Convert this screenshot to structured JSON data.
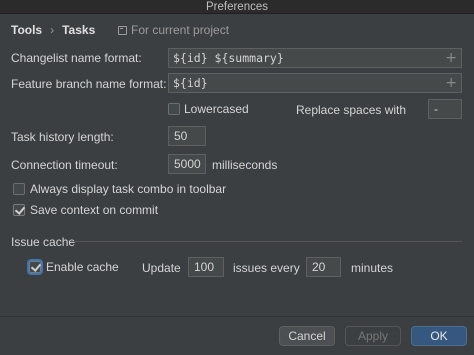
{
  "window": {
    "title": "Preferences"
  },
  "breadcrumb": {
    "root": "Tools",
    "separator": "›",
    "current": "Tasks"
  },
  "scope": {
    "label": "For current project",
    "icon": "project-scope-icon"
  },
  "changelist": {
    "label": "Changelist name format:",
    "value": "${id} ${summary}",
    "add_icon": "+"
  },
  "feature_branch": {
    "label": "Feature branch name format:",
    "value": "${id}",
    "add_icon": "+"
  },
  "lowercased": {
    "label": "Lowercased",
    "checked": false
  },
  "replace_spaces": {
    "label": "Replace spaces with",
    "value": "-"
  },
  "task_history": {
    "label": "Task history length:",
    "value": "50"
  },
  "connection_timeout": {
    "label": "Connection timeout:",
    "value": "5000",
    "unit": "milliseconds"
  },
  "always_display": {
    "label": "Always display task combo in toolbar",
    "checked": false
  },
  "save_context": {
    "label": "Save context on commit",
    "checked": true
  },
  "issue_cache": {
    "section_title": "Issue cache",
    "enable_label": "Enable cache",
    "enabled": true,
    "update_label": "Update",
    "update_value": "100",
    "issues_every_label": "issues every",
    "minutes_value": "20",
    "minutes_label": "minutes"
  },
  "buttons": {
    "cancel": "Cancel",
    "apply": "Apply",
    "ok": "OK"
  },
  "colors": {
    "background": "#3c3f41",
    "primary_button": "#365880",
    "focus_ring": "#3d75b5"
  }
}
